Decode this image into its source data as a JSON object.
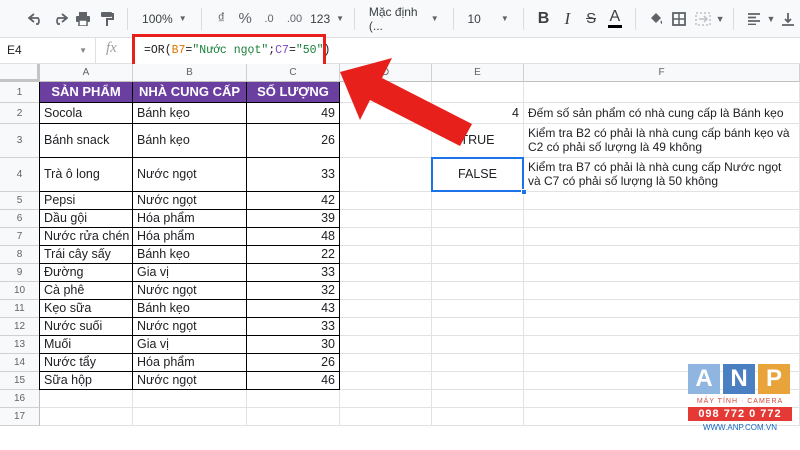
{
  "toolbar": {
    "zoom": "100%",
    "currency": "₫",
    "percent": "%",
    "decimal_decrease": ".0",
    "decimal_increase": ".00",
    "number_format": "123",
    "font": "Mặc định (...",
    "font_size": "10",
    "bold": "B",
    "italic": "I",
    "strike": "S",
    "text_color": "A"
  },
  "formula_bar": {
    "cell_ref": "E4",
    "fx": "fx",
    "parts": [
      "=OR(",
      "B7",
      "=",
      "\"Nước ngọt\"",
      ";",
      "C7",
      "=",
      "\"50\"",
      ")"
    ]
  },
  "columns": [
    "A",
    "B",
    "C",
    "D",
    "E",
    "F"
  ],
  "rows": [
    "1",
    "2",
    "3",
    "4",
    "5",
    "6",
    "7",
    "8",
    "9",
    "10",
    "11",
    "12",
    "13",
    "14",
    "15",
    "16",
    "17"
  ],
  "table": {
    "headers": [
      "SẢN PHẨM",
      "NHÀ CUNG CẤP",
      "SỐ LƯỢNG"
    ],
    "rows": [
      [
        "Socola",
        "Bánh kẹo",
        "49"
      ],
      [
        "Bánh snack",
        "Bánh kẹo",
        "26"
      ],
      [
        "Trà ô long",
        "Nước ngọt",
        "33"
      ],
      [
        "Pepsi",
        "Nước ngọt",
        "42"
      ],
      [
        "Dầu gội",
        "Hóa phẩm",
        "39"
      ],
      [
        "Nước rửa chén",
        "Hóa phẩm",
        "48"
      ],
      [
        "Trái cây sấy",
        "Bánh kẹo",
        "22"
      ],
      [
        "Đường",
        "Gia vị",
        "33"
      ],
      [
        "Cà phê",
        "Nước ngọt",
        "32"
      ],
      [
        "Kẹo sữa",
        "Bánh kẹo",
        "43"
      ],
      [
        "Nước suối",
        "Nước ngọt",
        "33"
      ],
      [
        "Muối",
        "Gia vị",
        "30"
      ],
      [
        "Nước tẩy",
        "Hóa phẩm",
        "26"
      ],
      [
        "Sữa hộp",
        "Nước ngọt",
        "46"
      ]
    ]
  },
  "results": {
    "e2": "4",
    "e3": "TRUE",
    "e4": "FALSE",
    "f2": "Đếm số sản phẩm có nhà cung cấp là Bánh kẹo",
    "f3": "Kiểm tra B2 có phải là nhà cung cấp bánh kẹo và C2 có phải số lượng là 49 không",
    "f4": "Kiểm tra B7 có phải là nhà cung cấp Nước ngọt và C7 có phải số lượng là 50 không"
  },
  "logo": {
    "letters": [
      "A",
      "N",
      "P"
    ],
    "tagline": "MÁY TÍNH · CAMERA",
    "phone": "098 772 0 772",
    "website": "WWW.ANP.COM.VN"
  },
  "colors": {
    "header_fill": "#6a3fa0",
    "highlight_box": "#e8201c",
    "arrow": "#e8201c",
    "selection": "#1a73e8"
  }
}
